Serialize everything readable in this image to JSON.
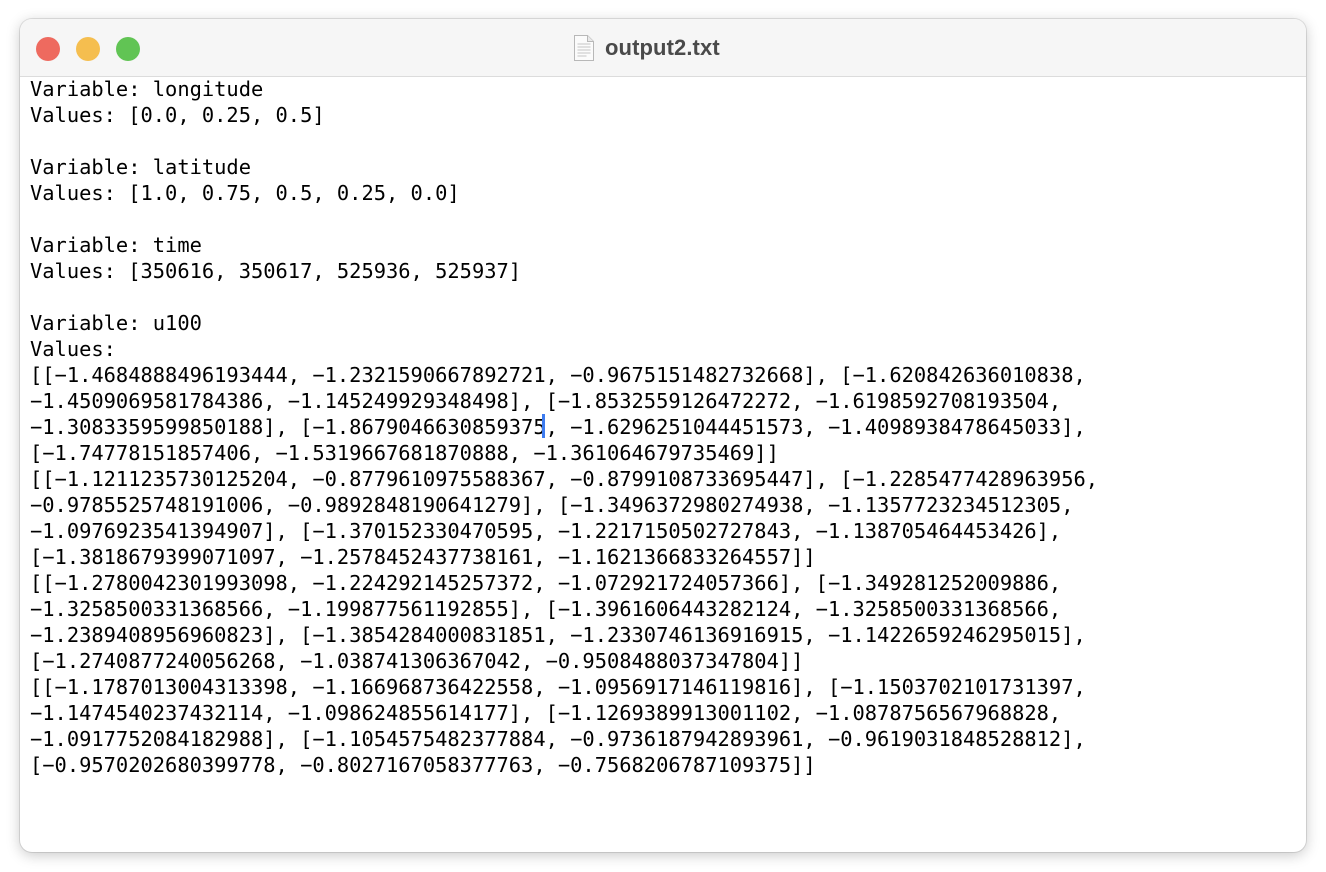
{
  "window": {
    "title": "output2.txt",
    "traffic_colors": {
      "close": "#ee6a5f",
      "minimize": "#f5be4f",
      "zoom": "#61c454"
    },
    "icons": {
      "file": "text-document-icon"
    }
  },
  "colors": {
    "caret": "#3d7cf0",
    "text": "#000000"
  },
  "document": {
    "lines": [
      "Variable: longitude",
      "Values: [0.0, 0.25, 0.5]",
      "",
      "Variable: latitude",
      "Values: [1.0, 0.75, 0.5, 0.25, 0.0]",
      "",
      "Variable: time",
      "Values: [350616, 350617, 525936, 525937]",
      "",
      "Variable: u100",
      "Values:",
      "[[−1.4684888496193444, −1.2321590667892721, −0.9675151482732668], [−1.620842636010838,",
      "−1.4509069581784386, −1.145249929348498], [−1.8532559126472272, −1.6198592708193504,",
      "−1.3083359599850188], [−1.8679046630859375, −1.6296251044451573, −1.4098938478645033],",
      "[−1.74778151857406, −1.5319667681870888, −1.361064679735469]]",
      "[[−1.1211235730125204, −0.8779610975588367, −0.8799108733695447], [−1.2285477428963956,",
      "−0.9785525748191006, −0.9892848190641279], [−1.3496372980274938, −1.1357723234512305,",
      "−1.0976923541394907], [−1.370152330470595, −1.2217150502727843, −1.138705464453426],",
      "[−1.3818679399071097, −1.2578452437738161, −1.1621366833264557]]",
      "[[−1.2780042301993098, −1.224292145257372, −1.072921724057366], [−1.349281252009886,",
      "−1.3258500331368566, −1.199877561192855], [−1.3961606443282124, −1.3258500331368566,",
      "−1.2389408956960823], [−1.3854284000831851, −1.2330746136916915, −1.1422659246295015],",
      "[−1.2740877240056268, −1.038741306367042, −0.9508488037347804]]",
      "[[−1.1787013004313398, −1.166968736422558, −1.0956917146119816], [−1.1503702101731397,",
      "−1.1474540237432114, −1.098624855614177], [−1.1269389913001102, −1.0878756567968828,",
      "−1.0917752084182988], [−1.1054575482377884, −0.9736187942893961, −0.9619031848528812],",
      "[−0.9570202680399778, −0.8027167058377763, −0.7568206787109375]]"
    ]
  }
}
